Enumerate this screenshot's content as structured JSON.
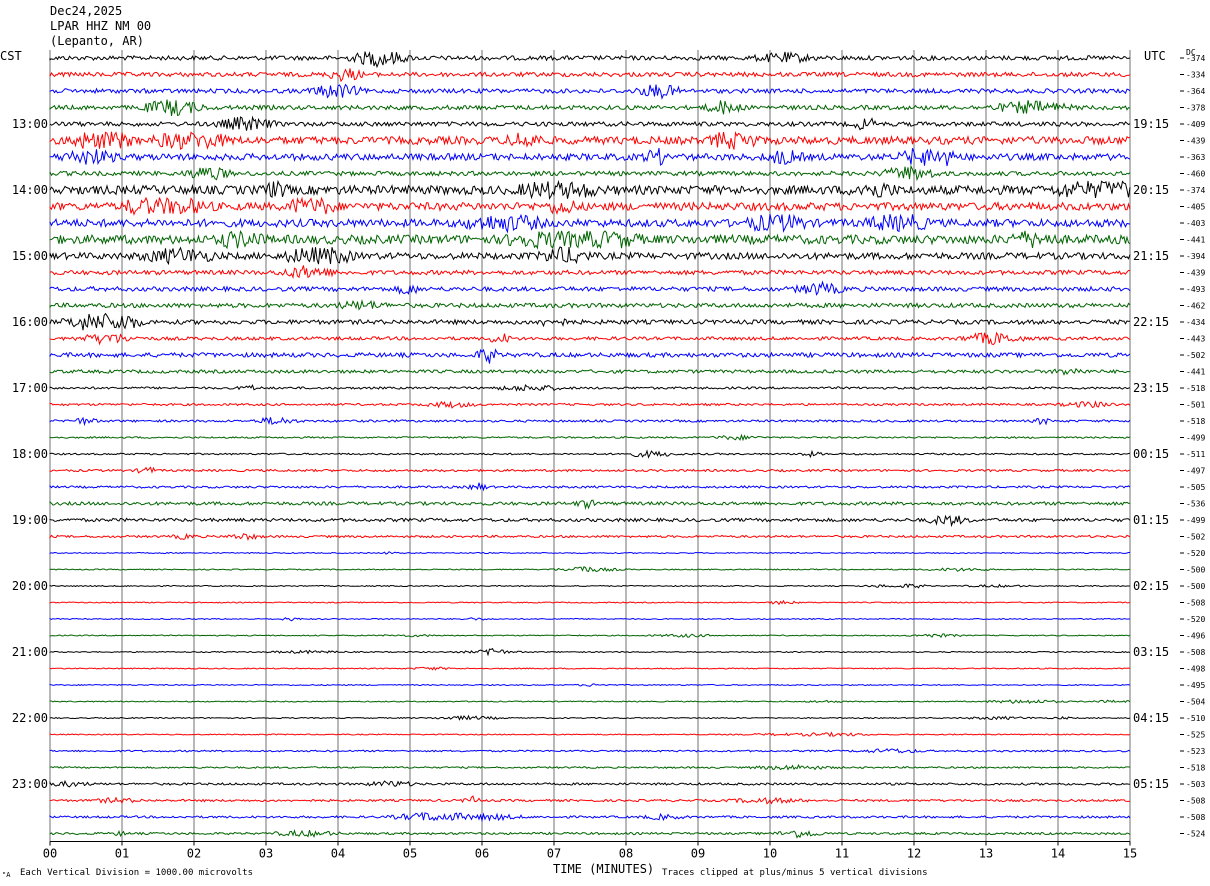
{
  "header": {
    "date": "Dec24,2025",
    "station": "LPAR HHZ NM 00",
    "location": "(Lepanto, AR)"
  },
  "labels": {
    "left_tz": "CST",
    "right_tz": "UTC",
    "dc_header": "DC",
    "x_axis_title": "TIME (MINUTES)",
    "scale_note": "Each Vertical Division = 1000.00 microvolts",
    "clip_note": "Traces clipped at plus/minus 5 vertical divisions",
    "corner_mark": "\"A"
  },
  "colors": {
    "trace_cycle": [
      "#000000",
      "#ff0000",
      "#0000ff",
      "#006400"
    ],
    "grid": "#000000"
  },
  "chart_data": {
    "type": "line",
    "title": "Dec24,2025 LPAR HHZ NM 00 (Lepanto, AR)",
    "xlabel": "TIME (MINUTES)",
    "xlim": [
      0,
      15
    ],
    "x_ticks": [
      "00",
      "01",
      "02",
      "03",
      "04",
      "05",
      "06",
      "07",
      "08",
      "09",
      "10",
      "11",
      "12",
      "13",
      "14",
      "15"
    ],
    "left_hour_labels": [
      "13:00",
      "14:00",
      "15:00",
      "16:00",
      "17:00",
      "18:00",
      "19:00",
      "20:00",
      "21:00",
      "22:00",
      "23:00"
    ],
    "right_hour_labels": [
      "19:15",
      "20:15",
      "21:15",
      "22:15",
      "23:15",
      "00:15",
      "01:15",
      "02:15",
      "03:15",
      "04:15",
      "05:15"
    ],
    "dc_offsets": [
      -374,
      -334,
      -364,
      -378,
      -409,
      -439,
      -363,
      -460,
      -374,
      -405,
      -403,
      -441,
      -394,
      -439,
      -493,
      -462,
      -434,
      -443,
      -502,
      -441,
      -518,
      -501,
      -518,
      -499,
      -511,
      -497,
      -505,
      -536,
      -499,
      -502,
      -520,
      -500,
      -500,
      -508,
      -520,
      -496,
      -508,
      -498,
      -495,
      -504,
      -510,
      -525,
      -523,
      -518,
      -503,
      -508,
      -508,
      -524
    ],
    "activity_levels": [
      4,
      4,
      4,
      4,
      4,
      7,
      6,
      4,
      8,
      7,
      7,
      8,
      6,
      4,
      4,
      4,
      4,
      3,
      4,
      3,
      2,
      2,
      2,
      1.5,
      1.5,
      2,
      2,
      3,
      3,
      2,
      1,
      1,
      1,
      1,
      1,
      1,
      1,
      1,
      1,
      1,
      1,
      1,
      1.5,
      1.5,
      2,
      2,
      2,
      2
    ],
    "grid": true
  }
}
